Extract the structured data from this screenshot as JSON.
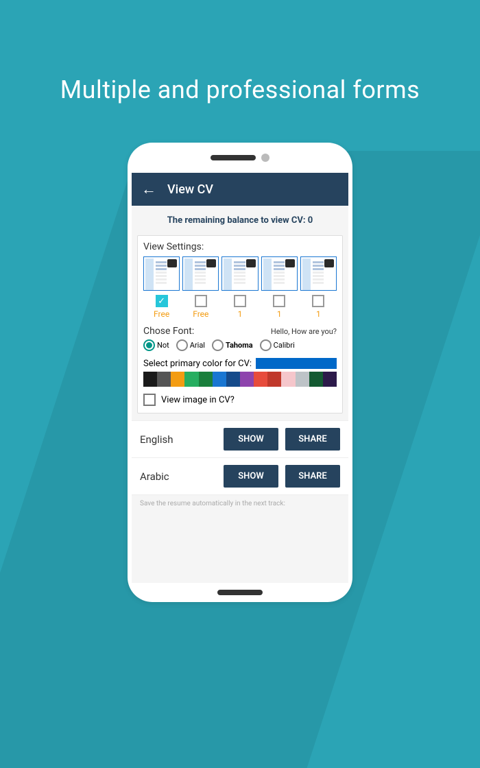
{
  "headline": "Multiple and professional forms",
  "appbar": {
    "title": "View CV"
  },
  "balance": "The remaining balance to view CV: 0",
  "settings": {
    "label": "View Settings:",
    "templates": [
      {
        "cost": "Free",
        "selected": true
      },
      {
        "cost": "Free",
        "selected": false
      },
      {
        "cost": "1",
        "selected": false
      },
      {
        "cost": "1",
        "selected": false
      },
      {
        "cost": "1",
        "selected": false
      }
    ],
    "font_label": "Chose Font:",
    "font_preview": "Hello, How are you?",
    "fonts": [
      {
        "label": "Not",
        "selected": true
      },
      {
        "label": "Arial",
        "selected": false
      },
      {
        "label": "Tahoma",
        "selected": false,
        "bold": true
      },
      {
        "label": "Calibri",
        "selected": false
      }
    ],
    "color_label": "Select primary color for CV:",
    "current_color": "#0068c8",
    "swatches": [
      "#1a1a1a",
      "#555555",
      "#f39c12",
      "#27ae60",
      "#1a7f3c",
      "#1976d2",
      "#154a8a",
      "#8e44ad",
      "#e74c3c",
      "#c0392b",
      "#f5c6cb",
      "#bdc3c7",
      "#145a32",
      "#2c1a4a"
    ],
    "image_check_label": "View image in CV?"
  },
  "langs": [
    {
      "name": "English",
      "show": "SHOW",
      "share": "SHARE"
    },
    {
      "name": "Arabic",
      "show": "SHOW",
      "share": "SHARE"
    }
  ],
  "footnote": "Save the resume automatically in the next track:"
}
